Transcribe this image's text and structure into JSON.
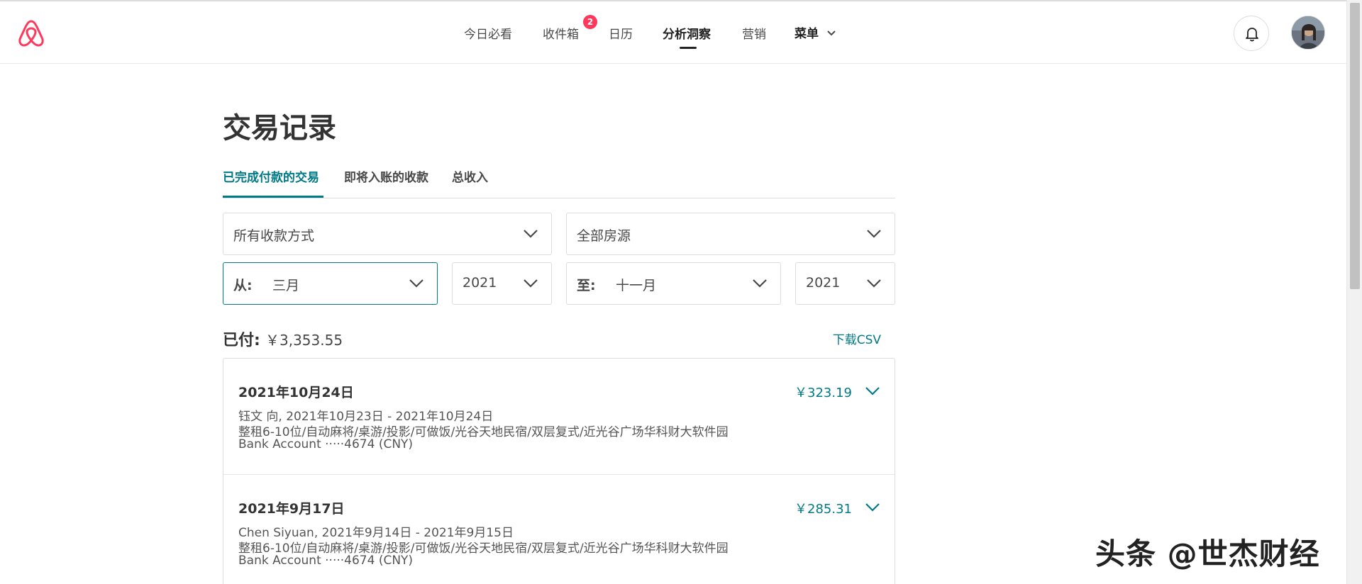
{
  "header": {
    "nav": [
      {
        "label": "今日必看"
      },
      {
        "label": "收件箱"
      },
      {
        "label": "日历"
      },
      {
        "label": "分析洞察"
      },
      {
        "label": "营销"
      },
      {
        "label": "菜单"
      }
    ],
    "inbox_badge": "2",
    "active_nav": "分析洞察"
  },
  "page": {
    "title": "交易记录",
    "tabs": [
      {
        "label": "已完成付款的交易",
        "active": true
      },
      {
        "label": "即将入账的收款",
        "active": false
      },
      {
        "label": "总收入",
        "active": false
      }
    ]
  },
  "filters": {
    "payout_method": "所有收款方式",
    "listing": "全部房源",
    "from_label": "从:",
    "from_month": "三月",
    "from_year": "2021",
    "to_label": "至:",
    "to_month": "十一月",
    "to_year": "2021"
  },
  "summary": {
    "paid_label": "已付:",
    "paid_value": "￥3,353.55",
    "download_label": "下载CSV"
  },
  "transactions": [
    {
      "date": "2021年10月24日",
      "amount": "￥323.19",
      "guest_dates": "钰文 向, 2021年10月23日 - 2021年10月24日",
      "listing": "整租6-10位/自动麻将/桌游/投影/可做饭/光谷天地民宿/双层复式/近光谷广场华科财大软件园",
      "account": "Bank Account ·····4674 (CNY)"
    },
    {
      "date": "2021年9月17日",
      "amount": "￥285.31",
      "guest_dates": "Chen Siyuan, 2021年9月14日 - 2021年9月15日",
      "listing": "整租6-10位/自动麻将/桌游/投影/可做饭/光谷天地民宿/双层复式/近光谷广场华科财大软件园",
      "account": "Bank Account ·····4674 (CNY)"
    }
  ],
  "watermark": "头条 @世杰财经",
  "colors": {
    "brand": "#ff385c",
    "accent": "#007a87",
    "text": "#484848"
  }
}
